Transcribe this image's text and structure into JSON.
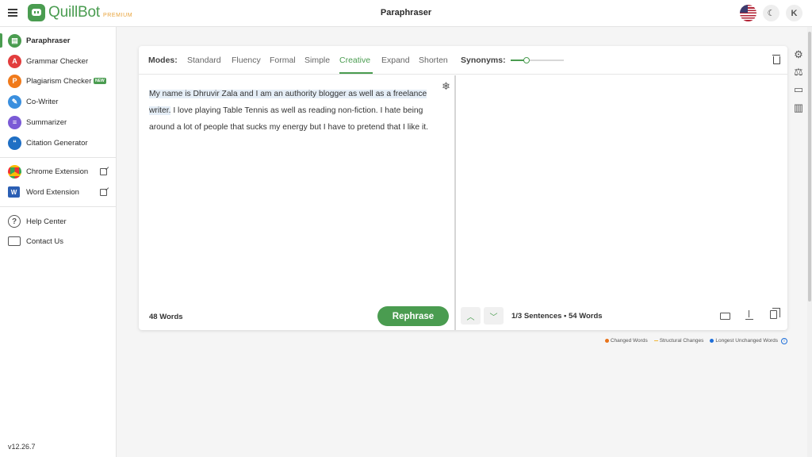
{
  "app": {
    "name": "QuillBot",
    "badge": "PREMIUM",
    "page_title": "Paraphraser",
    "user_initial": "K"
  },
  "colors": {
    "brand": "#4a9c50",
    "changed": "#e8731a",
    "structural": "#f0b73a",
    "unchanged": "#1e6fd9"
  },
  "sidebar": {
    "tools": [
      {
        "label": "Paraphraser",
        "icon": "paraphraser-icon",
        "color": "#4a9c50",
        "active": true
      },
      {
        "label": "Grammar Checker",
        "icon": "grammar-checker-icon",
        "color": "#e23d3d"
      },
      {
        "label": "Plagiarism Checker",
        "icon": "plagiarism-checker-icon",
        "color": "#f07a1b",
        "badge": "NEW"
      },
      {
        "label": "Co-Writer",
        "icon": "co-writer-icon",
        "color": "#3a8fde"
      },
      {
        "label": "Summarizer",
        "icon": "summarizer-icon",
        "color": "#7b5bd6"
      },
      {
        "label": "Citation Generator",
        "icon": "citation-generator-icon",
        "color": "#1f6fc4"
      }
    ],
    "extensions": [
      {
        "label": "Chrome Extension",
        "icon": "chrome-icon"
      },
      {
        "label": "Word Extension",
        "icon": "word-icon"
      }
    ],
    "support": [
      {
        "label": "Help Center",
        "icon": "help-icon"
      },
      {
        "label": "Contact Us",
        "icon": "mail-icon"
      }
    ],
    "version": "v12.26.7"
  },
  "modes_bar": {
    "label": "Modes:",
    "modes": [
      "Standard",
      "Fluency",
      "Formal",
      "Simple",
      "Creative",
      "Expand",
      "Shorten"
    ],
    "active_mode": "Creative",
    "synonyms_label": "Synonyms:",
    "synonyms_level": 0.3
  },
  "input": {
    "highlighted_text": "My name is Dhruvir Zala and I am an authority blogger as well as a freelance writer.",
    "rest_text": " I love playing Table Tennis as well as reading non-fiction. I hate being around a lot of people that sucks my energy but I have to pretend that I like it.",
    "word_count": "48 Words",
    "rephrase_label": "Rephrase"
  },
  "output": {
    "sentence_position": "1/3",
    "sentence_suffix": " Sentences • 54 Words"
  },
  "legend": {
    "changed": "Changed Words",
    "structural": "Structural Changes",
    "unchanged": "Longest Unchanged Words"
  }
}
